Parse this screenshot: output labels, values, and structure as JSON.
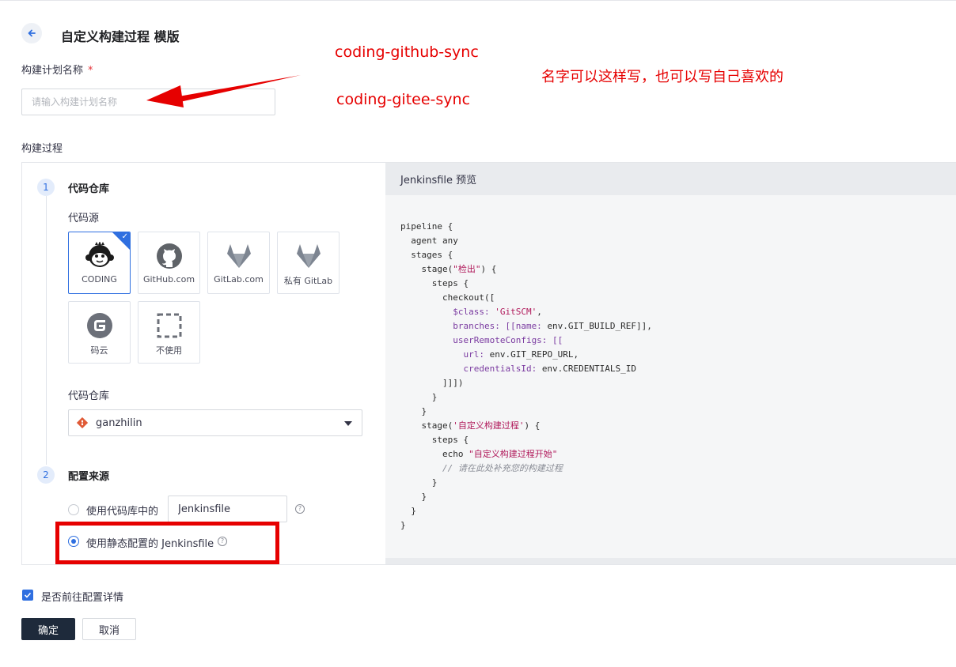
{
  "header": {
    "title": "自定义构建过程 模版"
  },
  "form": {
    "plan_name_label": "构建计划名称",
    "required_mark": "*",
    "plan_name_placeholder": "请输入构建计划名称",
    "plan_name_value": "",
    "build_process_label": "构建过程"
  },
  "annotations": {
    "name_example_1": "coding-github-sync",
    "name_example_2": "coding-gitee-sync",
    "note": "名字可以这样写，也可以写自己喜欢的",
    "color": "#e60000"
  },
  "steps": [
    {
      "number": "1",
      "title": "代码仓库",
      "source_label": "代码源",
      "sources": [
        {
          "label": "CODING",
          "icon": "coding-monkey-icon",
          "selected": true
        },
        {
          "label": "GitHub.com",
          "icon": "github-icon",
          "selected": false
        },
        {
          "label": "GitLab.com",
          "icon": "gitlab-icon",
          "selected": false
        },
        {
          "label": "私有 GitLab",
          "icon": "gitlab-icon",
          "selected": false
        },
        {
          "label": "码云",
          "icon": "gitee-icon",
          "selected": false
        },
        {
          "label": "不使用",
          "icon": "dashed-square-icon",
          "selected": false
        }
      ],
      "repo_label": "代码仓库",
      "repo_value": "ganzhilin"
    },
    {
      "number": "2",
      "title": "配置来源",
      "options": [
        {
          "label": "使用代码库中的",
          "input_value": "Jenkinsfile",
          "selected": false
        },
        {
          "label": "使用静态配置的 Jenkinsfile",
          "selected": true
        }
      ]
    }
  ],
  "preview": {
    "title": "Jenkinsfile 预览",
    "code": {
      "l1": "pipeline {",
      "l2": "  agent any",
      "l3": "  stages {",
      "l4a": "    stage(",
      "l4s": "\"检出\"",
      "l4b": ") {",
      "l5": "      steps {",
      "l6": "        checkout([",
      "l7k": "          $class: ",
      "l7s": "'GitSCM'",
      "l7b": ",",
      "l8k": "          branches: [[name: ",
      "l8b": "env.GIT_BUILD_REF]],",
      "l9k": "          userRemoteConfigs: [[",
      "l10k": "            url: ",
      "l10b": "env.GIT_REPO_URL,",
      "l11k": "            credentialsId: ",
      "l11b": "env.CREDENTIALS_ID",
      "l12": "        ]]])",
      "l13": "      }",
      "l14": "    }",
      "l15a": "    stage(",
      "l15s": "'自定义构建过程'",
      "l15b": ") {",
      "l16": "      steps {",
      "l17a": "        echo ",
      "l17s": "\"自定义构建过程开始\"",
      "l18": "        // 请在此处补充您的构建过程",
      "l19": "      }",
      "l20": "    }",
      "l21": "  }",
      "l22": "}"
    }
  },
  "footer": {
    "goto_config_label": "是否前往配置详情",
    "goto_config_checked": true,
    "confirm_label": "确定",
    "cancel_label": "取消"
  },
  "colors": {
    "accent": "#2f6fe0",
    "primary_button": "#1e2a3b",
    "annotation_red": "#e60000"
  }
}
